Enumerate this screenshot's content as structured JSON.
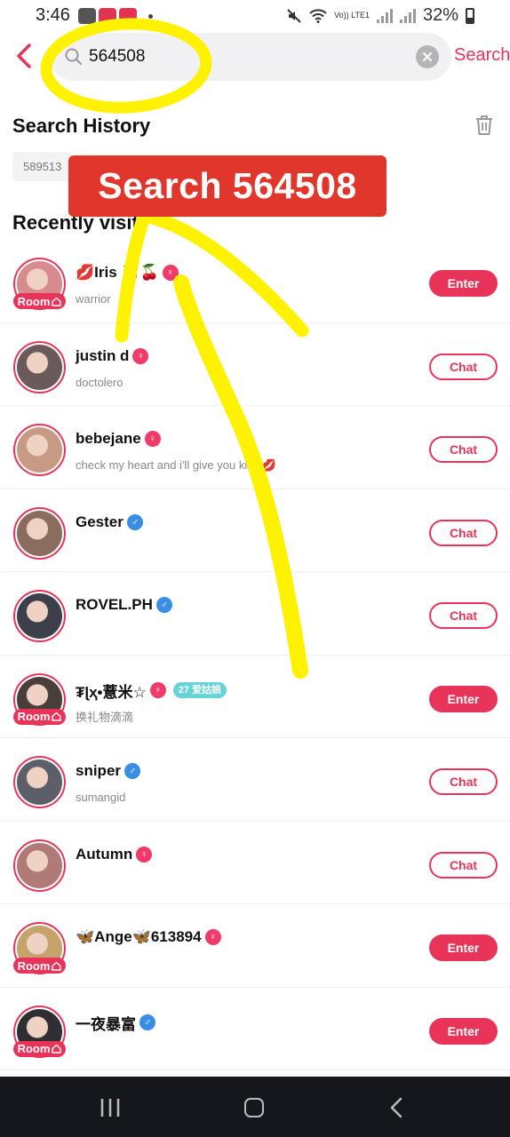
{
  "status_bar": {
    "time": "3:46",
    "network": "Vo)) LTE1",
    "battery": "32%"
  },
  "search": {
    "value": "564508",
    "submit_label": "Search"
  },
  "history": {
    "title": "Search History",
    "items": [
      "589513"
    ]
  },
  "recent": {
    "title": "Recently visit"
  },
  "overlay": {
    "label": "Search 564508"
  },
  "buttons": {
    "enter": "Enter",
    "chat": "Chat",
    "room": "Room"
  },
  "rows": [
    {
      "name": "💋Iris 🍒🍒",
      "sub": "warrior",
      "gender": "female",
      "room": true,
      "action": "Enter"
    },
    {
      "name": "justin d",
      "sub": "doctolero",
      "gender": "female",
      "room": false,
      "action": "Chat"
    },
    {
      "name": "bebejane",
      "sub": "check my heart and i'll give you kiss 💋",
      "gender": "female",
      "room": false,
      "action": "Chat"
    },
    {
      "name": "Gester",
      "sub": "",
      "gender": "male",
      "room": false,
      "action": "Chat"
    },
    {
      "name": "ROVEL.PH",
      "sub": "",
      "gender": "male",
      "room": false,
      "action": "Chat"
    },
    {
      "name": "₮ɭҳ•薏米☆",
      "sub": "换礼物滴滴",
      "gender": "female",
      "room": true,
      "action": "Enter",
      "badge": "27 爱姑娘"
    },
    {
      "name": "sniper",
      "sub": "sumangid",
      "gender": "male",
      "room": false,
      "action": "Chat"
    },
    {
      "name": "Autumn",
      "sub": "",
      "gender": "female",
      "room": false,
      "action": "Chat"
    },
    {
      "name": "🦋Ange🦋613894",
      "sub": "",
      "gender": "female",
      "room": true,
      "action": "Enter"
    },
    {
      "name": "一夜暴富",
      "sub": "",
      "gender": "male",
      "room": true,
      "action": "Enter"
    }
  ],
  "colors": {
    "accent": "#e9345a",
    "male": "#3a8de4",
    "overlay": "#e0362c",
    "annotation": "#fff200"
  }
}
